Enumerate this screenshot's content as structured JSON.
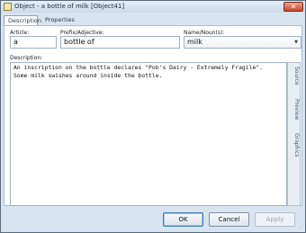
{
  "window": {
    "title": "Object - a bottle of milk  [Object41]",
    "close_glyph": "✕"
  },
  "tabs": [
    {
      "label": "Description"
    },
    {
      "label": "Properties"
    }
  ],
  "fields": {
    "article": {
      "label": "Article:",
      "value": "a"
    },
    "prefix": {
      "label": "Prefix/Adjective:",
      "value": "bottle of"
    },
    "name": {
      "label": "Name/Noun(s):",
      "value": "milk"
    }
  },
  "description": {
    "label": "Description:",
    "lines": [
      "An inscription on the bottle declares \"Pob's Dairy - Extremely Fragile\".",
      "Some milk swishes around inside the bottle."
    ]
  },
  "side_tabs": [
    {
      "label": "Source"
    },
    {
      "label": "Preview"
    },
    {
      "label": "Graphics"
    }
  ],
  "buttons": {
    "ok": "OK",
    "cancel": "Cancel",
    "apply": "Apply"
  },
  "icons": {
    "app": "object-icon",
    "dropdown": "chevron-down-icon",
    "grip": "resize-grip-icon"
  }
}
